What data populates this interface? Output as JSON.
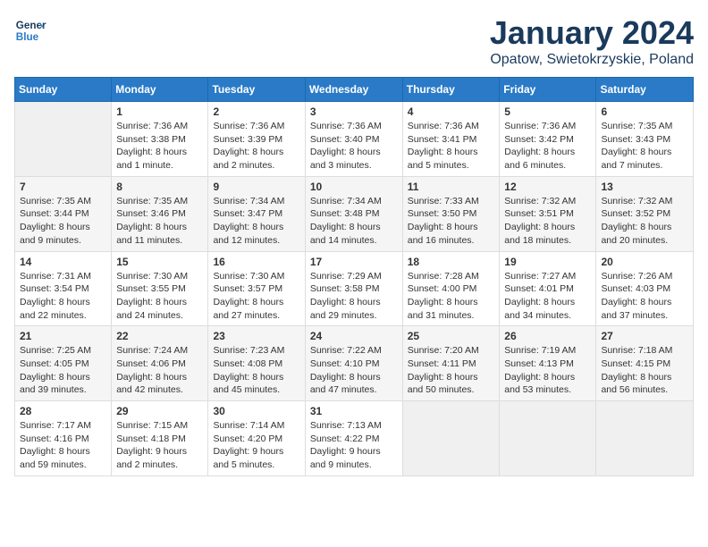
{
  "logo": {
    "line1": "General",
    "line2": "Blue"
  },
  "title": "January 2024",
  "location": "Opatow, Swietokrzyskie, Poland",
  "weekdays": [
    "Sunday",
    "Monday",
    "Tuesday",
    "Wednesday",
    "Thursday",
    "Friday",
    "Saturday"
  ],
  "weeks": [
    [
      {
        "day": "",
        "sunrise": "",
        "sunset": "",
        "daylight": ""
      },
      {
        "day": "1",
        "sunrise": "Sunrise: 7:36 AM",
        "sunset": "Sunset: 3:38 PM",
        "daylight": "Daylight: 8 hours and 1 minute."
      },
      {
        "day": "2",
        "sunrise": "Sunrise: 7:36 AM",
        "sunset": "Sunset: 3:39 PM",
        "daylight": "Daylight: 8 hours and 2 minutes."
      },
      {
        "day": "3",
        "sunrise": "Sunrise: 7:36 AM",
        "sunset": "Sunset: 3:40 PM",
        "daylight": "Daylight: 8 hours and 3 minutes."
      },
      {
        "day": "4",
        "sunrise": "Sunrise: 7:36 AM",
        "sunset": "Sunset: 3:41 PM",
        "daylight": "Daylight: 8 hours and 5 minutes."
      },
      {
        "day": "5",
        "sunrise": "Sunrise: 7:36 AM",
        "sunset": "Sunset: 3:42 PM",
        "daylight": "Daylight: 8 hours and 6 minutes."
      },
      {
        "day": "6",
        "sunrise": "Sunrise: 7:35 AM",
        "sunset": "Sunset: 3:43 PM",
        "daylight": "Daylight: 8 hours and 7 minutes."
      }
    ],
    [
      {
        "day": "7",
        "sunrise": "Sunrise: 7:35 AM",
        "sunset": "Sunset: 3:44 PM",
        "daylight": "Daylight: 8 hours and 9 minutes."
      },
      {
        "day": "8",
        "sunrise": "Sunrise: 7:35 AM",
        "sunset": "Sunset: 3:46 PM",
        "daylight": "Daylight: 8 hours and 11 minutes."
      },
      {
        "day": "9",
        "sunrise": "Sunrise: 7:34 AM",
        "sunset": "Sunset: 3:47 PM",
        "daylight": "Daylight: 8 hours and 12 minutes."
      },
      {
        "day": "10",
        "sunrise": "Sunrise: 7:34 AM",
        "sunset": "Sunset: 3:48 PM",
        "daylight": "Daylight: 8 hours and 14 minutes."
      },
      {
        "day": "11",
        "sunrise": "Sunrise: 7:33 AM",
        "sunset": "Sunset: 3:50 PM",
        "daylight": "Daylight: 8 hours and 16 minutes."
      },
      {
        "day": "12",
        "sunrise": "Sunrise: 7:32 AM",
        "sunset": "Sunset: 3:51 PM",
        "daylight": "Daylight: 8 hours and 18 minutes."
      },
      {
        "day": "13",
        "sunrise": "Sunrise: 7:32 AM",
        "sunset": "Sunset: 3:52 PM",
        "daylight": "Daylight: 8 hours and 20 minutes."
      }
    ],
    [
      {
        "day": "14",
        "sunrise": "Sunrise: 7:31 AM",
        "sunset": "Sunset: 3:54 PM",
        "daylight": "Daylight: 8 hours and 22 minutes."
      },
      {
        "day": "15",
        "sunrise": "Sunrise: 7:30 AM",
        "sunset": "Sunset: 3:55 PM",
        "daylight": "Daylight: 8 hours and 24 minutes."
      },
      {
        "day": "16",
        "sunrise": "Sunrise: 7:30 AM",
        "sunset": "Sunset: 3:57 PM",
        "daylight": "Daylight: 8 hours and 27 minutes."
      },
      {
        "day": "17",
        "sunrise": "Sunrise: 7:29 AM",
        "sunset": "Sunset: 3:58 PM",
        "daylight": "Daylight: 8 hours and 29 minutes."
      },
      {
        "day": "18",
        "sunrise": "Sunrise: 7:28 AM",
        "sunset": "Sunset: 4:00 PM",
        "daylight": "Daylight: 8 hours and 31 minutes."
      },
      {
        "day": "19",
        "sunrise": "Sunrise: 7:27 AM",
        "sunset": "Sunset: 4:01 PM",
        "daylight": "Daylight: 8 hours and 34 minutes."
      },
      {
        "day": "20",
        "sunrise": "Sunrise: 7:26 AM",
        "sunset": "Sunset: 4:03 PM",
        "daylight": "Daylight: 8 hours and 37 minutes."
      }
    ],
    [
      {
        "day": "21",
        "sunrise": "Sunrise: 7:25 AM",
        "sunset": "Sunset: 4:05 PM",
        "daylight": "Daylight: 8 hours and 39 minutes."
      },
      {
        "day": "22",
        "sunrise": "Sunrise: 7:24 AM",
        "sunset": "Sunset: 4:06 PM",
        "daylight": "Daylight: 8 hours and 42 minutes."
      },
      {
        "day": "23",
        "sunrise": "Sunrise: 7:23 AM",
        "sunset": "Sunset: 4:08 PM",
        "daylight": "Daylight: 8 hours and 45 minutes."
      },
      {
        "day": "24",
        "sunrise": "Sunrise: 7:22 AM",
        "sunset": "Sunset: 4:10 PM",
        "daylight": "Daylight: 8 hours and 47 minutes."
      },
      {
        "day": "25",
        "sunrise": "Sunrise: 7:20 AM",
        "sunset": "Sunset: 4:11 PM",
        "daylight": "Daylight: 8 hours and 50 minutes."
      },
      {
        "day": "26",
        "sunrise": "Sunrise: 7:19 AM",
        "sunset": "Sunset: 4:13 PM",
        "daylight": "Daylight: 8 hours and 53 minutes."
      },
      {
        "day": "27",
        "sunrise": "Sunrise: 7:18 AM",
        "sunset": "Sunset: 4:15 PM",
        "daylight": "Daylight: 8 hours and 56 minutes."
      }
    ],
    [
      {
        "day": "28",
        "sunrise": "Sunrise: 7:17 AM",
        "sunset": "Sunset: 4:16 PM",
        "daylight": "Daylight: 8 hours and 59 minutes."
      },
      {
        "day": "29",
        "sunrise": "Sunrise: 7:15 AM",
        "sunset": "Sunset: 4:18 PM",
        "daylight": "Daylight: 9 hours and 2 minutes."
      },
      {
        "day": "30",
        "sunrise": "Sunrise: 7:14 AM",
        "sunset": "Sunset: 4:20 PM",
        "daylight": "Daylight: 9 hours and 5 minutes."
      },
      {
        "day": "31",
        "sunrise": "Sunrise: 7:13 AM",
        "sunset": "Sunset: 4:22 PM",
        "daylight": "Daylight: 9 hours and 9 minutes."
      },
      {
        "day": "",
        "sunrise": "",
        "sunset": "",
        "daylight": ""
      },
      {
        "day": "",
        "sunrise": "",
        "sunset": "",
        "daylight": ""
      },
      {
        "day": "",
        "sunrise": "",
        "sunset": "",
        "daylight": ""
      }
    ]
  ]
}
